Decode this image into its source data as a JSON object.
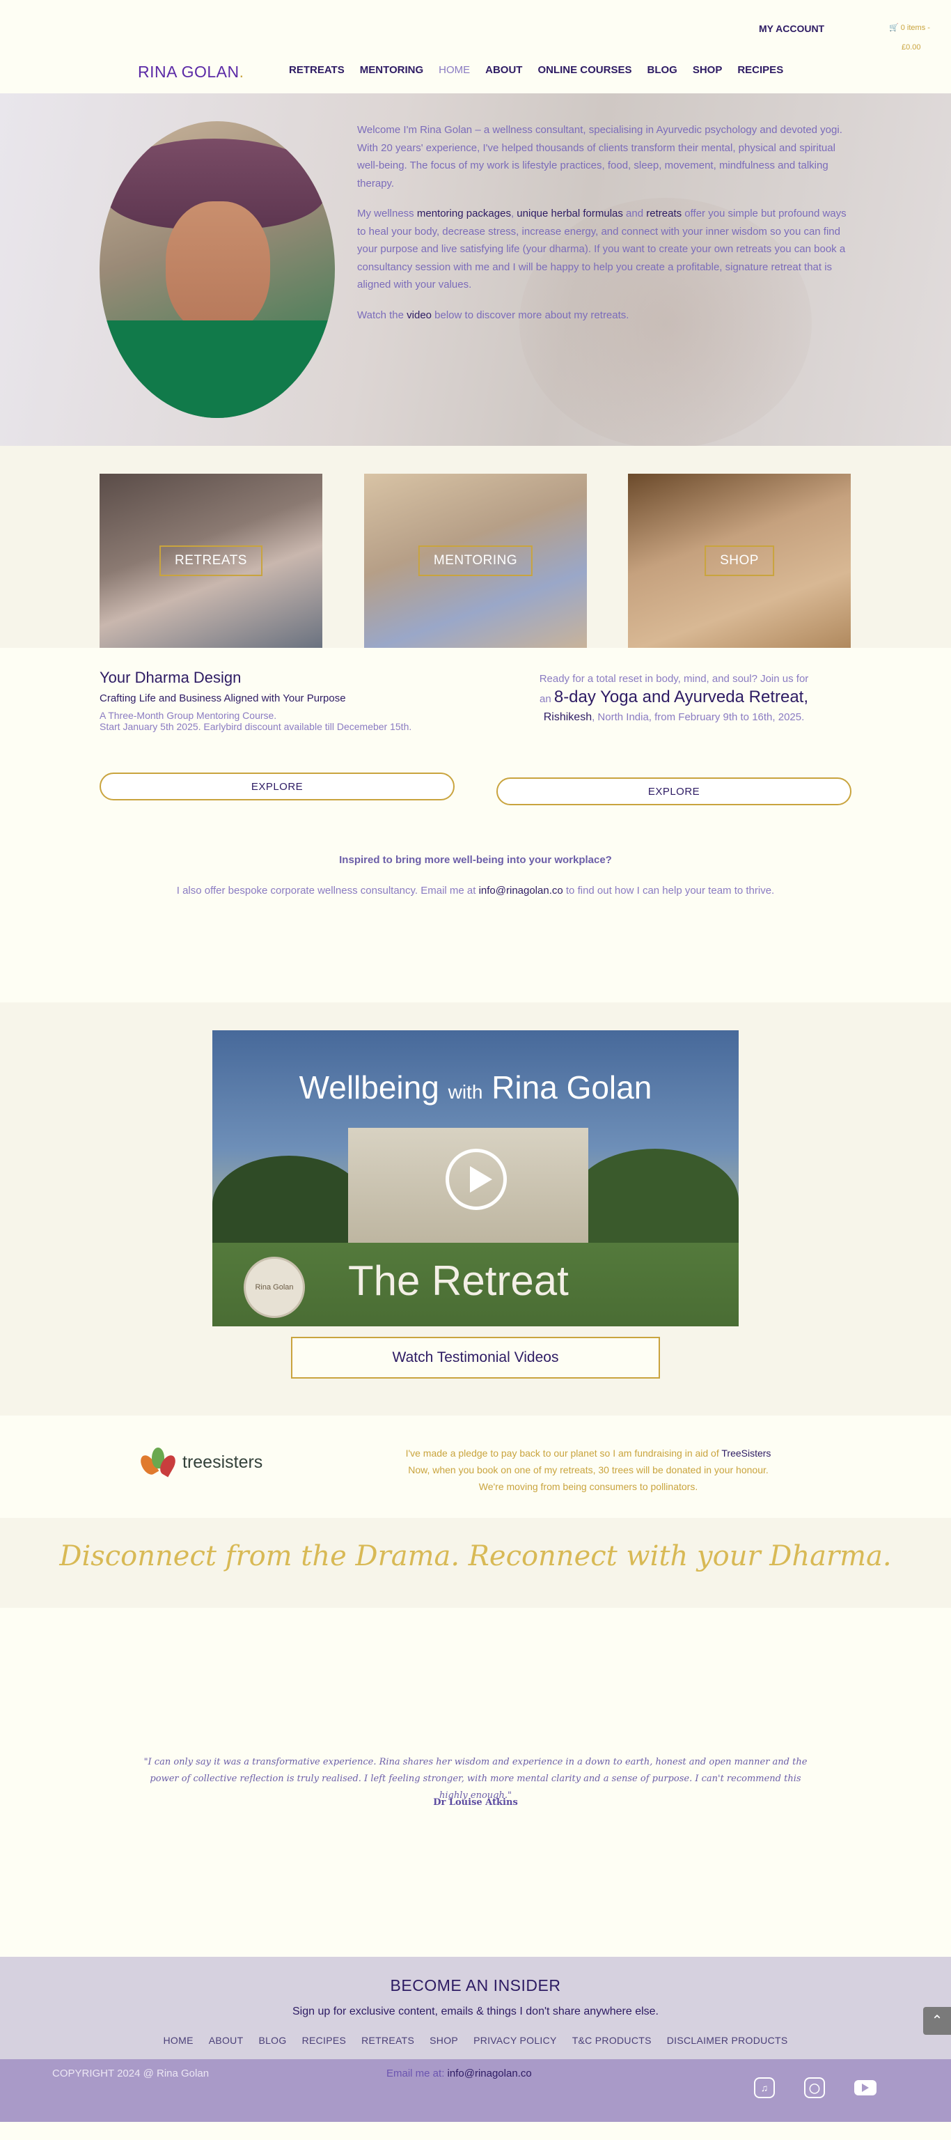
{
  "header": {
    "my_account": "MY ACCOUNT",
    "cart_items": "🛒 0 items -",
    "cart_total": "£0.00",
    "logo": "RINA GOLAN",
    "logo_dot": ".",
    "nav": [
      "RETREATS",
      "MENTORING",
      "HOME",
      "ABOUT",
      "ONLINE COURSES",
      "BLOG",
      "SHOP",
      "RECIPES"
    ],
    "active_nav": "HOME"
  },
  "hero": {
    "p1": "Welcome I'm Rina Golan – a wellness consultant, specialising in Ayurvedic psychology and devoted yogi. With 20 years' experience, I've helped thousands of clients transform their mental, physical and spiritual well-being. The focus of my work is lifestyle practices, food, sleep, movement, mindfulness and talking therapy.",
    "p2_a": "My wellness ",
    "p2_link1": "mentoring packages",
    "p2_b": ", ",
    "p2_link2": "unique herbal formulas",
    "p2_c": " and ",
    "p2_link3": "retreats",
    "p2_d": " offer you simple but profound ways to heal your body, decrease stress, increase energy, and connect with your inner wisdom so you can find your purpose and live satisfying life (your dharma). If you want to create your own retreats you can book a consultancy session with me and I will be happy to help you create a profitable, signature retreat that is aligned with your values.",
    "p3_a": "Watch the ",
    "p3_link": "video",
    "p3_b": " below to discover more about my retreats."
  },
  "cards": [
    "RETREATS",
    "MENTORING",
    "SHOP"
  ],
  "programs": {
    "left_title": "Your Dharma Design",
    "left_sub": "Crafting Life and Business Aligned with Your Purpose",
    "left_desc1": "A Three-Month Group Mentoring Course.",
    "left_desc2": " Start January 5th 2025. Earlybird discount available till Decemeber 15th.",
    "right_line1": "Ready for a total reset in body, mind, and soul? Join us for",
    "right_an": "an ",
    "right_big": "8-day Yoga and Ayurveda Retreat,",
    "right_place": "Rishikesh",
    "right_rest": ", North India, from February 9th to 16th, 2025.",
    "explore": "EXPLORE"
  },
  "corporate": {
    "title": "Inspired to bring more well-being into your workplace?",
    "text_a": "I also offer bespoke corporate wellness consultancy. Email me at ",
    "email": "info@rinagolan.co",
    "text_b": " to find out how I can help your team to thrive."
  },
  "video": {
    "title_a": "Wellbeing ",
    "title_with": "with",
    "title_b": " Rina Golan",
    "subtitle": "The Retreat",
    "seal_text": "Rina Golan",
    "watch_button": "Watch Testimonial Videos"
  },
  "treesisters": {
    "logo_text": "treesisters",
    "line1_a": "I've made a pledge to pay back to our planet so I am fundraising in aid of ",
    "line1_link": "TreeSisters",
    "line2": "Now, when you book on one of my retreats, 30 trees will be donated in your honour.",
    "line3": "We're moving from being consumers to pollinators."
  },
  "tagline": "Disconnect from the Drama. Reconnect with your Dharma.",
  "testimonial": {
    "quote": "\"I can only say it was a transformative experience. Rina shares her wisdom and experience in a down to earth, honest and open manner and the power of collective reflection is truly realised. I left feeling stronger, with more mental clarity and a sense of purpose. I can't recommend this highly enough.\"",
    "author": "Dr Louise Atkins"
  },
  "newsletter": {
    "title": "BECOME AN INSIDER",
    "subtitle": "Sign up for exclusive content, emails & things I don't share anywhere else.",
    "links": [
      "HOME",
      "ABOUT",
      "BLOG",
      "RECIPES",
      "RETREATS",
      "SHOP",
      "PRIVACY POLICY",
      "T&C PRODUCTS",
      "DISCLAIMER PRODUCTS"
    ]
  },
  "footer": {
    "copyright": "COPYRIGHT 2024 @ Rina Golan",
    "email_label": "Email me at: ",
    "email": "info@rinagolan.co",
    "socials": [
      "tiktok-icon",
      "instagram-icon",
      "youtube-icon"
    ]
  },
  "colors": {
    "brand_purple": "#2d1b63",
    "text_lavender": "#8a7bc2",
    "gold_accent": "#c9a43e",
    "footer_bg": "#a99ac8",
    "newsletter_bg": "#d6d1df"
  }
}
